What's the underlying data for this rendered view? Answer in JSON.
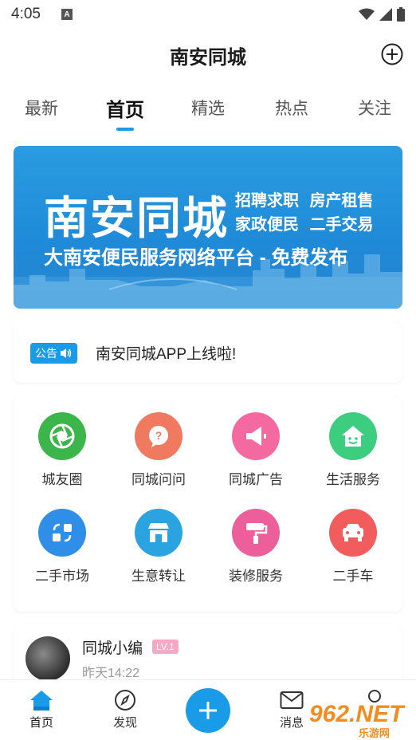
{
  "status_bar": {
    "time": "4:05",
    "notification_icon": "A"
  },
  "header": {
    "title": "南安同城",
    "add_icon": "plus-circle-icon"
  },
  "tabs": [
    {
      "label": "最新"
    },
    {
      "label": "首页",
      "active": true
    },
    {
      "label": "精选"
    },
    {
      "label": "热点"
    },
    {
      "label": "关注"
    }
  ],
  "banner": {
    "title": "南安同城",
    "line1": "招聘求职 房产租售",
    "line2": "家政便民 二手交易",
    "subtitle": "大南安便民服务网络平台 - 免费发布"
  },
  "notice": {
    "badge": "公告",
    "text": "南安同城APP上线啦!"
  },
  "services": [
    {
      "label": "城友圈",
      "icon": "aperture-icon",
      "color": "#3cb64a"
    },
    {
      "label": "同城问问",
      "icon": "question-bubble-icon",
      "color": "#f07a5f"
    },
    {
      "label": "同城广告",
      "icon": "megaphone-icon",
      "color": "#f46aa0"
    },
    {
      "label": "生活服务",
      "icon": "house-smile-icon",
      "color": "#3ccd7e"
    },
    {
      "label": "二手市场",
      "icon": "exchange-icon",
      "color": "#2f8fe8"
    },
    {
      "label": "生意转让",
      "icon": "shop-icon",
      "color": "#2aa3e0"
    },
    {
      "label": "装修服务",
      "icon": "paint-roller-icon",
      "color": "#ec5f9a"
    },
    {
      "label": "二手车",
      "icon": "car-icon",
      "color": "#f25c5c"
    }
  ],
  "post": {
    "author": "同城小编",
    "level": "LV.1",
    "time": "昨天14:22"
  },
  "bottom_nav": {
    "home": "首页",
    "discover": "发现",
    "messages": "消息"
  },
  "watermark": {
    "text": "962.NET",
    "sub": "乐游网"
  },
  "colors": {
    "accent": "#1a9be8"
  }
}
